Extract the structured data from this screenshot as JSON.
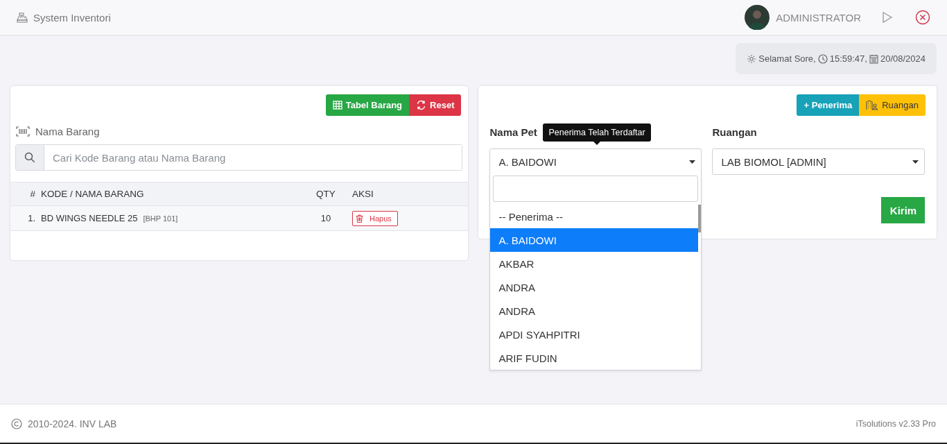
{
  "header": {
    "title": "System Inventori",
    "user": "ADMINISTRATOR"
  },
  "status": {
    "greeting": "Selamat Sore,",
    "time": "15:59:47,",
    "date": "20/08/2024"
  },
  "item_panel": {
    "buttons": [
      {
        "label": "Tabel Barang",
        "kind": "table"
      },
      {
        "label": "Reset",
        "kind": "reset"
      }
    ],
    "field_label": "Nama Barang",
    "search": {
      "placeholder": "Cari Kode Barang atau Nama Barang"
    },
    "table": {
      "columns": [
        "#",
        "KODE / NAMA BARANG",
        "QTY",
        "AKSI"
      ],
      "rows": [
        {
          "no": "1.",
          "name": "BD WINGS NEEDLE 25",
          "code": "[BHP 101]",
          "qty": "10",
          "action": "Hapus"
        }
      ]
    }
  },
  "receiver_panel": {
    "buttons": [
      {
        "label": "+ Penerima",
        "kind": "add"
      },
      {
        "label": "Ruangan",
        "kind": "room"
      }
    ],
    "receiver_label": "Nama Pet",
    "tooltip": "Penerima Telah Terdaftar",
    "receiver_select": {
      "value": "A. BAIDOWI",
      "expanded": true,
      "options": [
        {
          "label": "-- Penerima --",
          "selected": false
        },
        {
          "label": "A. BAIDOWI",
          "selected": true
        },
        {
          "label": "AKBAR",
          "selected": false
        },
        {
          "label": "ANDRA",
          "selected": false
        },
        {
          "label": "ANDRA",
          "selected": false
        },
        {
          "label": "APDI SYAHPITRI",
          "selected": false
        },
        {
          "label": "ARIF FUDIN",
          "selected": false
        }
      ]
    },
    "room_label": "Ruangan",
    "room_select": {
      "value": "LAB BIOMOL [ADMIN]"
    },
    "submit": "Kirim"
  },
  "footer": {
    "copyright": "2010-2024. INV LAB",
    "version": "iTsolutions v2.33 Pro"
  }
}
